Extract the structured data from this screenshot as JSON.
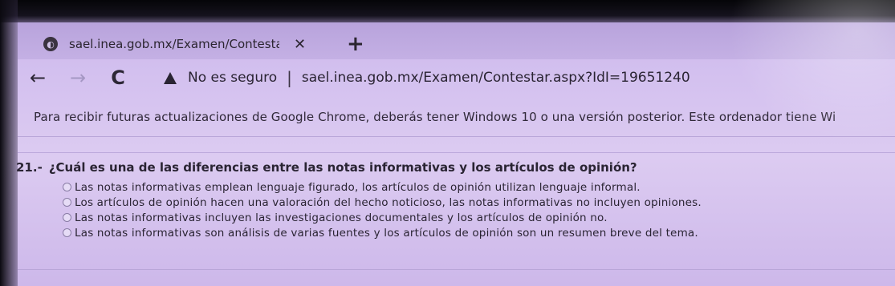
{
  "tab": {
    "title": "sael.inea.gob.mx/Examen/Contesta",
    "close_label": "✕",
    "new_tab_label": "+"
  },
  "toolbar": {
    "back_label": "←",
    "forward_label": "→",
    "reload_label": "C",
    "security_text": "No es seguro",
    "separator": "|",
    "url": "sael.inea.gob.mx/Examen/Contestar.aspx?IdI=19651240"
  },
  "infobar": {
    "message": "Para recibir futuras actualizaciones de Google Chrome, deberás tener Windows 10 o una versión posterior. Este ordenador tiene Wi"
  },
  "question": {
    "number": "21.-",
    "text": "¿Cuál es una de las diferencias entre las notas informativas y los artículos de opinión?",
    "options": [
      "Las notas informativas emplean lenguaje figurado, los artículos de opinión utilizan lenguaje informal.",
      "Los artículos de opinión hacen una valoración del hecho noticioso, las notas informativas no incluyen opiniones.",
      "Las notas informativas incluyen las investigaciones documentales y los artículos de opinión no.",
      "Las notas informativas son análisis de varias fuentes y los artículos de opinión son un resumen breve del tema."
    ]
  },
  "colors": {
    "page_background": "#d3c0ef",
    "text": "#2a2433"
  },
  "icons": {
    "favicon": "globe-icon",
    "security": "warning-triangle-icon"
  }
}
